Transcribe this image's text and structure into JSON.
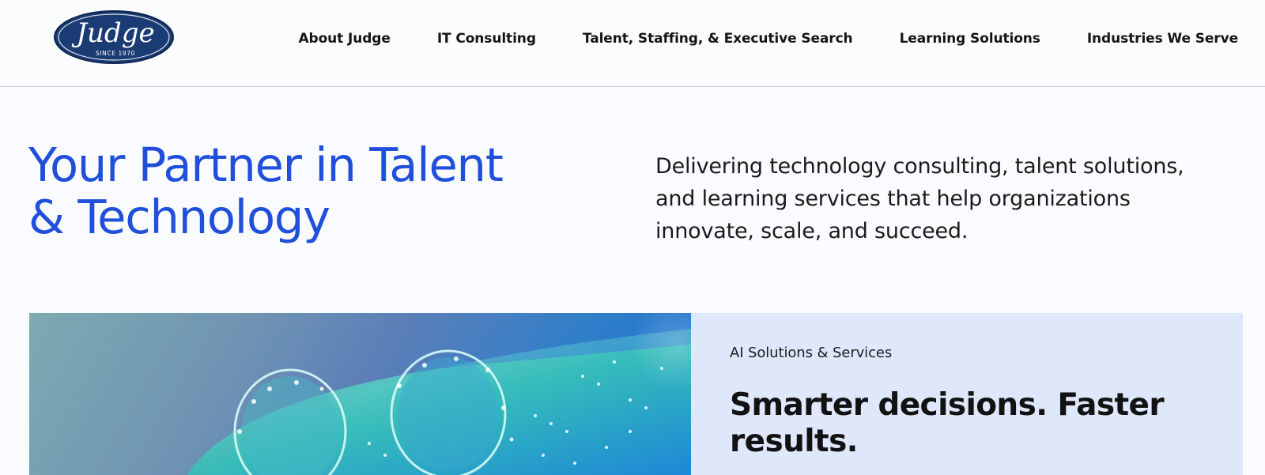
{
  "brand": {
    "logo_text": "Judge",
    "logo_tagline": "SINCE 1970",
    "logo_color": "#1a3b73"
  },
  "nav": {
    "items": [
      {
        "label": "About Judge"
      },
      {
        "label": "IT Consulting"
      },
      {
        "label": "Talent, Staffing, & Executive Search"
      },
      {
        "label": "Learning Solutions"
      },
      {
        "label": "Industries We Serve"
      }
    ]
  },
  "hero": {
    "title_line1": "Your Partner in Talent",
    "title_line2": "& Technology",
    "description": "Delivering technology consulting, talent solutions, and learning services that help organizations innovate, scale, and succeed.",
    "title_color": "#1f4fdb"
  },
  "feature": {
    "eyebrow": "AI Solutions & Services",
    "heading": "Smarter decisions. Faster results.",
    "panel_color": "#dfe8fb",
    "image_icon": "fiber-optic-tubes-image"
  }
}
